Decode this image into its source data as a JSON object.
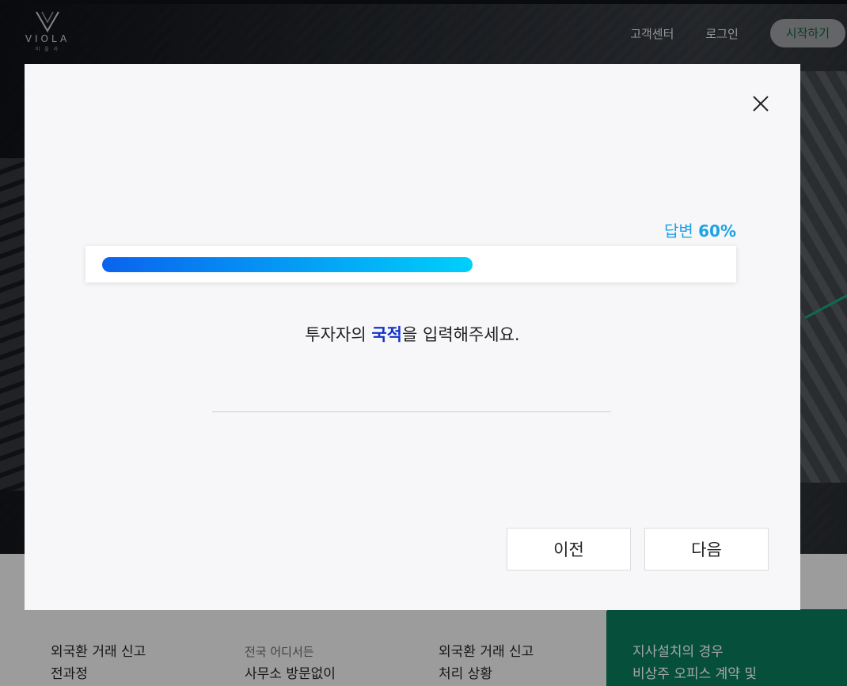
{
  "header": {
    "logo_text": "VIOLA",
    "logo_sub": "비 올 라",
    "nav": {
      "customer_center": "고객센터",
      "login": "로그인",
      "start": "시작하기"
    }
  },
  "features": [
    {
      "line1": "외국환 거래 신고",
      "line2": "전과정",
      "sub": ""
    },
    {
      "line1": "사무소 방문없이",
      "sub": "전국 어디서든"
    },
    {
      "line1": "외국환 거래 신고",
      "line2": "처리 상황"
    },
    {
      "line1": "지사설치의 경우",
      "line2": "비상주 오피스 계약 및"
    }
  ],
  "modal": {
    "progress": {
      "prefix": "답변",
      "percent_text": "60%",
      "value": 0.6
    },
    "question": {
      "before": "투자자의 ",
      "highlight": "국적",
      "after": "을 입력해주세요."
    },
    "input": {
      "value": "",
      "placeholder": ""
    },
    "buttons": {
      "prev": "이전",
      "next": "다음"
    },
    "close_icon": "close-icon"
  },
  "colors": {
    "progress_start": "#0a63ee",
    "progress_end": "#00d0fa",
    "highlight": "#1133c8",
    "label": "#1ba3e6",
    "green_panel": "#0a7a5a"
  }
}
